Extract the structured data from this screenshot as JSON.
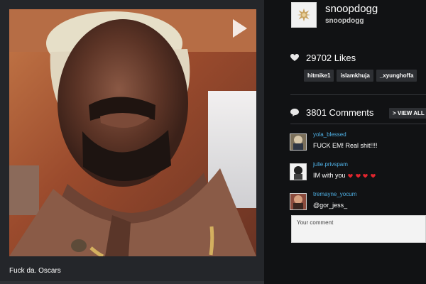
{
  "post": {
    "caption": "Fuck da. Oscars"
  },
  "profile": {
    "username": "snoopdogg",
    "handle": "snoopdogg",
    "avatar_icon": "leaf-badge-icon"
  },
  "likes": {
    "count_text": "29702 Likes",
    "icon": "heart-icon",
    "likers": [
      "hitmike1",
      "islamkhuja",
      "_xyunghoffa"
    ]
  },
  "comments": {
    "count_text": "3801 Comments",
    "icon": "comment-bubble-icon",
    "view_all_label": "> VIEW ALL",
    "items": [
      {
        "user": "yola_blessed",
        "text": "FUCK EM! Real shit!!!!"
      },
      {
        "user": "julie.privspam",
        "text": "IM with you",
        "hearts": 4
      },
      {
        "user": "tremayne_yocum",
        "text": "@gor_jess_"
      }
    ],
    "input_placeholder": "Your comment"
  },
  "colors": {
    "accent": "#4fb1e6",
    "heart_red": "#e2252e",
    "panel_dark": "#111214",
    "panel_mid": "#24262a"
  }
}
